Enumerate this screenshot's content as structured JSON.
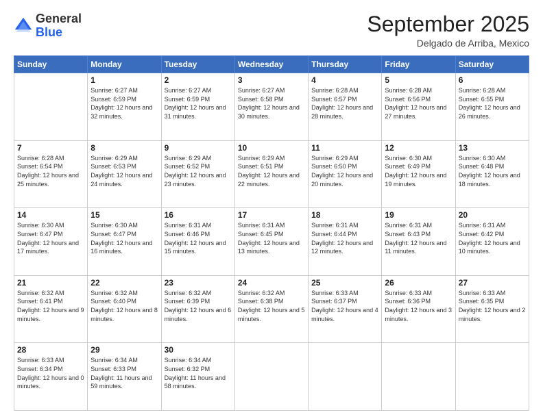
{
  "logo": {
    "general": "General",
    "blue": "Blue"
  },
  "header": {
    "month": "September 2025",
    "location": "Delgado de Arriba, Mexico"
  },
  "days_of_week": [
    "Sunday",
    "Monday",
    "Tuesday",
    "Wednesday",
    "Thursday",
    "Friday",
    "Saturday"
  ],
  "weeks": [
    [
      {
        "day": "",
        "info": ""
      },
      {
        "day": "1",
        "info": "Sunrise: 6:27 AM\nSunset: 6:59 PM\nDaylight: 12 hours\nand 32 minutes."
      },
      {
        "day": "2",
        "info": "Sunrise: 6:27 AM\nSunset: 6:59 PM\nDaylight: 12 hours\nand 31 minutes."
      },
      {
        "day": "3",
        "info": "Sunrise: 6:27 AM\nSunset: 6:58 PM\nDaylight: 12 hours\nand 30 minutes."
      },
      {
        "day": "4",
        "info": "Sunrise: 6:28 AM\nSunset: 6:57 PM\nDaylight: 12 hours\nand 28 minutes."
      },
      {
        "day": "5",
        "info": "Sunrise: 6:28 AM\nSunset: 6:56 PM\nDaylight: 12 hours\nand 27 minutes."
      },
      {
        "day": "6",
        "info": "Sunrise: 6:28 AM\nSunset: 6:55 PM\nDaylight: 12 hours\nand 26 minutes."
      }
    ],
    [
      {
        "day": "7",
        "info": "Sunrise: 6:28 AM\nSunset: 6:54 PM\nDaylight: 12 hours\nand 25 minutes."
      },
      {
        "day": "8",
        "info": "Sunrise: 6:29 AM\nSunset: 6:53 PM\nDaylight: 12 hours\nand 24 minutes."
      },
      {
        "day": "9",
        "info": "Sunrise: 6:29 AM\nSunset: 6:52 PM\nDaylight: 12 hours\nand 23 minutes."
      },
      {
        "day": "10",
        "info": "Sunrise: 6:29 AM\nSunset: 6:51 PM\nDaylight: 12 hours\nand 22 minutes."
      },
      {
        "day": "11",
        "info": "Sunrise: 6:29 AM\nSunset: 6:50 PM\nDaylight: 12 hours\nand 20 minutes."
      },
      {
        "day": "12",
        "info": "Sunrise: 6:30 AM\nSunset: 6:49 PM\nDaylight: 12 hours\nand 19 minutes."
      },
      {
        "day": "13",
        "info": "Sunrise: 6:30 AM\nSunset: 6:48 PM\nDaylight: 12 hours\nand 18 minutes."
      }
    ],
    [
      {
        "day": "14",
        "info": "Sunrise: 6:30 AM\nSunset: 6:47 PM\nDaylight: 12 hours\nand 17 minutes."
      },
      {
        "day": "15",
        "info": "Sunrise: 6:30 AM\nSunset: 6:47 PM\nDaylight: 12 hours\nand 16 minutes."
      },
      {
        "day": "16",
        "info": "Sunrise: 6:31 AM\nSunset: 6:46 PM\nDaylight: 12 hours\nand 15 minutes."
      },
      {
        "day": "17",
        "info": "Sunrise: 6:31 AM\nSunset: 6:45 PM\nDaylight: 12 hours\nand 13 minutes."
      },
      {
        "day": "18",
        "info": "Sunrise: 6:31 AM\nSunset: 6:44 PM\nDaylight: 12 hours\nand 12 minutes."
      },
      {
        "day": "19",
        "info": "Sunrise: 6:31 AM\nSunset: 6:43 PM\nDaylight: 12 hours\nand 11 minutes."
      },
      {
        "day": "20",
        "info": "Sunrise: 6:31 AM\nSunset: 6:42 PM\nDaylight: 12 hours\nand 10 minutes."
      }
    ],
    [
      {
        "day": "21",
        "info": "Sunrise: 6:32 AM\nSunset: 6:41 PM\nDaylight: 12 hours\nand 9 minutes."
      },
      {
        "day": "22",
        "info": "Sunrise: 6:32 AM\nSunset: 6:40 PM\nDaylight: 12 hours\nand 8 minutes."
      },
      {
        "day": "23",
        "info": "Sunrise: 6:32 AM\nSunset: 6:39 PM\nDaylight: 12 hours\nand 6 minutes."
      },
      {
        "day": "24",
        "info": "Sunrise: 6:32 AM\nSunset: 6:38 PM\nDaylight: 12 hours\nand 5 minutes."
      },
      {
        "day": "25",
        "info": "Sunrise: 6:33 AM\nSunset: 6:37 PM\nDaylight: 12 hours\nand 4 minutes."
      },
      {
        "day": "26",
        "info": "Sunrise: 6:33 AM\nSunset: 6:36 PM\nDaylight: 12 hours\nand 3 minutes."
      },
      {
        "day": "27",
        "info": "Sunrise: 6:33 AM\nSunset: 6:35 PM\nDaylight: 12 hours\nand 2 minutes."
      }
    ],
    [
      {
        "day": "28",
        "info": "Sunrise: 6:33 AM\nSunset: 6:34 PM\nDaylight: 12 hours\nand 0 minutes."
      },
      {
        "day": "29",
        "info": "Sunrise: 6:34 AM\nSunset: 6:33 PM\nDaylight: 11 hours\nand 59 minutes."
      },
      {
        "day": "30",
        "info": "Sunrise: 6:34 AM\nSunset: 6:32 PM\nDaylight: 11 hours\nand 58 minutes."
      },
      {
        "day": "",
        "info": ""
      },
      {
        "day": "",
        "info": ""
      },
      {
        "day": "",
        "info": ""
      },
      {
        "day": "",
        "info": ""
      }
    ]
  ]
}
